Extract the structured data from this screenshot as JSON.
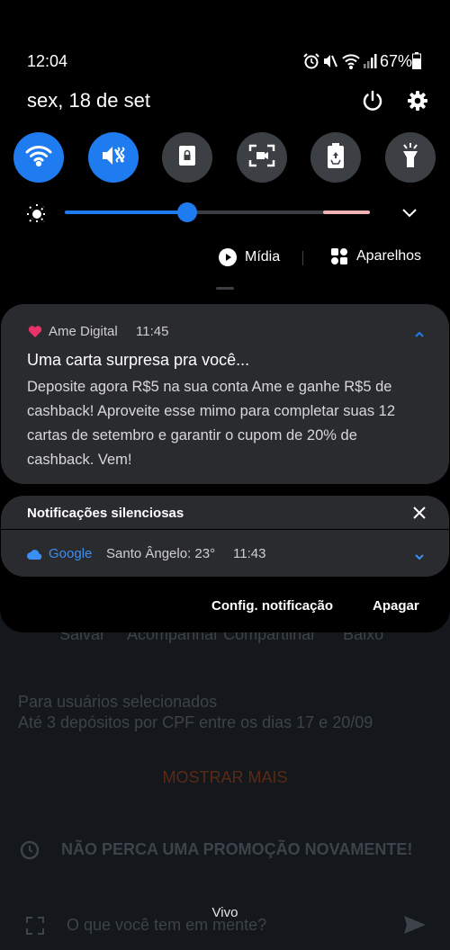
{
  "status_bar": {
    "time": "12:04",
    "battery": "67%"
  },
  "header": {
    "date": "sex, 18 de set"
  },
  "quick_settings": {
    "tiles": [
      {
        "icon": "wifi-icon",
        "active": true
      },
      {
        "icon": "mute-vibrate-icon",
        "active": true
      },
      {
        "icon": "lock-rotation-icon",
        "active": false
      },
      {
        "icon": "screen-capture-icon",
        "active": false
      },
      {
        "icon": "power-saving-icon",
        "active": false
      },
      {
        "icon": "flashlight-icon",
        "active": false
      }
    ],
    "brightness_level": 0.4
  },
  "media_row": {
    "media_label": "Mídia",
    "devices_label": "Aparelhos"
  },
  "notification": {
    "app_name": "Ame Digital",
    "time": "11:45",
    "title": "Uma carta surpresa pra você...",
    "body": "Deposite agora R$5 na sua conta Ame e ganhe R$5 de cashback! Aproveite esse mimo para completar suas 12 cartas de setembro e garantir o cupom de 20% de cashback. Vem!"
  },
  "silent": {
    "header": "Notificações silenciosas",
    "app_name": "Google",
    "text": "Santo Ângelo: 23°",
    "time": "11:43"
  },
  "actions": {
    "settings_label": "Config. notificação",
    "clear_label": "Apagar"
  },
  "background": {
    "action_labels": "Salvar     Acompanhar Compartilhar      Baixo",
    "line1": "Para usuários selecionados",
    "line2": "Até 3 depósitos por CPF entre os dias 17 e 20/09",
    "show_more": "MOSTRAR MAIS",
    "promo": "NÃO PERCA UMA PROMOÇÃO NOVAMENTE!",
    "input_placeholder": "O que você tem em mente?",
    "carrier": "Vivo"
  },
  "colors": {
    "accent": "#1f7cf0",
    "ame_pink": "#e8336a",
    "card_bg": "#2a2b2e"
  }
}
